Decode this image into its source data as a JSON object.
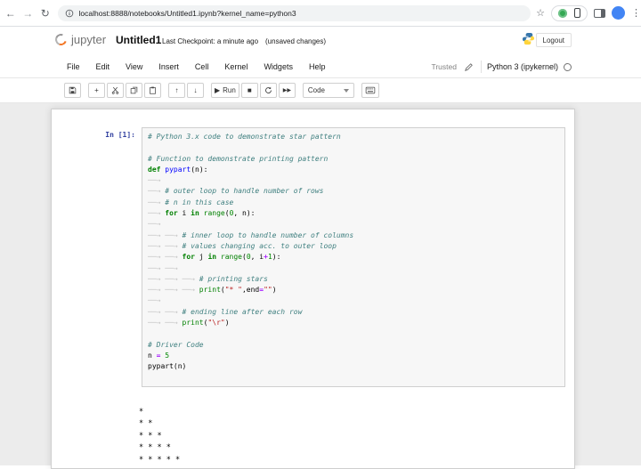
{
  "browser": {
    "url": "localhost:8888/notebooks/Untitled1.ipynb?kernel_name=python3"
  },
  "header": {
    "logo_text": "jupyter",
    "title": "Untitled1",
    "checkpoint": "Last Checkpoint: a minute ago",
    "unsaved": "(unsaved changes)",
    "logout_label": "Logout"
  },
  "menu": {
    "items": [
      "File",
      "Edit",
      "View",
      "Insert",
      "Cell",
      "Kernel",
      "Widgets",
      "Help"
    ],
    "trusted_label": "Trusted",
    "kernel_name": "Python 3 (ipykernel)"
  },
  "toolbar": {
    "run_label": "Run",
    "cell_type": "Code",
    "up_glyph": "↑",
    "down_glyph": "↓",
    "play_glyph": "▶",
    "stop_glyph": "■",
    "ff_glyph": "▶▶",
    "plus_glyph": "+"
  },
  "cell": {
    "prompt": "In [1]:",
    "code_lines": [
      [
        [
          "c",
          "# Python 3.x code to demonstrate star pattern"
        ]
      ],
      [],
      [
        [
          "c",
          "# Function to demonstrate printing pattern"
        ]
      ],
      [
        [
          "k",
          "def"
        ],
        [
          "t",
          " "
        ],
        [
          "d",
          "pypart"
        ],
        [
          "t",
          "(n):"
        ]
      ],
      [
        [
          "T"
        ]
      ],
      [
        [
          "T"
        ],
        [
          "c",
          "# outer loop to handle number of rows"
        ]
      ],
      [
        [
          "T"
        ],
        [
          "c",
          "# n in this case"
        ]
      ],
      [
        [
          "T"
        ],
        [
          "k",
          "for"
        ],
        [
          "t",
          " i "
        ],
        [
          "k",
          "in"
        ],
        [
          "t",
          " "
        ],
        [
          "b",
          "range"
        ],
        [
          "t",
          "("
        ],
        [
          "n",
          "0"
        ],
        [
          "t",
          ", n):"
        ]
      ],
      [
        [
          "T"
        ]
      ],
      [
        [
          "T"
        ],
        [
          "T"
        ],
        [
          "c",
          "# inner loop to handle number of columns"
        ]
      ],
      [
        [
          "T"
        ],
        [
          "T"
        ],
        [
          "c",
          "# values changing acc. to outer loop"
        ]
      ],
      [
        [
          "T"
        ],
        [
          "T"
        ],
        [
          "k",
          "for"
        ],
        [
          "t",
          " j "
        ],
        [
          "k",
          "in"
        ],
        [
          "t",
          " "
        ],
        [
          "b",
          "range"
        ],
        [
          "t",
          "("
        ],
        [
          "n",
          "0"
        ],
        [
          "t",
          ", i"
        ],
        [
          "o",
          "+"
        ],
        [
          "n",
          "1"
        ],
        [
          "t",
          "):"
        ]
      ],
      [
        [
          "T"
        ],
        [
          "T"
        ]
      ],
      [
        [
          "T"
        ],
        [
          "T"
        ],
        [
          "T"
        ],
        [
          "c",
          "# printing stars"
        ]
      ],
      [
        [
          "T"
        ],
        [
          "T"
        ],
        [
          "T"
        ],
        [
          "b",
          "print"
        ],
        [
          "t",
          "("
        ],
        [
          "s",
          "\"* \""
        ],
        [
          "t",
          ",end"
        ],
        [
          "o",
          "="
        ],
        [
          "s",
          "\"\""
        ],
        [
          "t",
          ")"
        ]
      ],
      [
        [
          "T"
        ]
      ],
      [
        [
          "T"
        ],
        [
          "T"
        ],
        [
          "c",
          "# ending line after each row"
        ]
      ],
      [
        [
          "T"
        ],
        [
          "T"
        ],
        [
          "b",
          "print"
        ],
        [
          "t",
          "("
        ],
        [
          "s",
          "\"\\r\""
        ],
        [
          "t",
          ")"
        ]
      ],
      [],
      [
        [
          "c",
          "# Driver Code"
        ]
      ],
      [
        [
          "t",
          "n "
        ],
        [
          "o",
          "="
        ],
        [
          "t",
          " "
        ],
        [
          "n",
          "5"
        ]
      ],
      [
        [
          "t",
          "pypart(n)"
        ]
      ]
    ]
  },
  "output": {
    "lines": [
      "*",
      "* *",
      "* * *",
      "* * * *",
      "* * * * *"
    ]
  },
  "colors": {
    "prompt": "#303F9F",
    "comment": "#408080",
    "keyword": "#008000",
    "string": "#BA2121",
    "operator": "#AA22FF",
    "def_name": "#0000FF",
    "jupyter_orange": "#f37726",
    "python_blue": "#3776ab",
    "python_yellow": "#ffd43b",
    "extension_green": "#34a853",
    "avatar_blue": "#4285f4"
  }
}
